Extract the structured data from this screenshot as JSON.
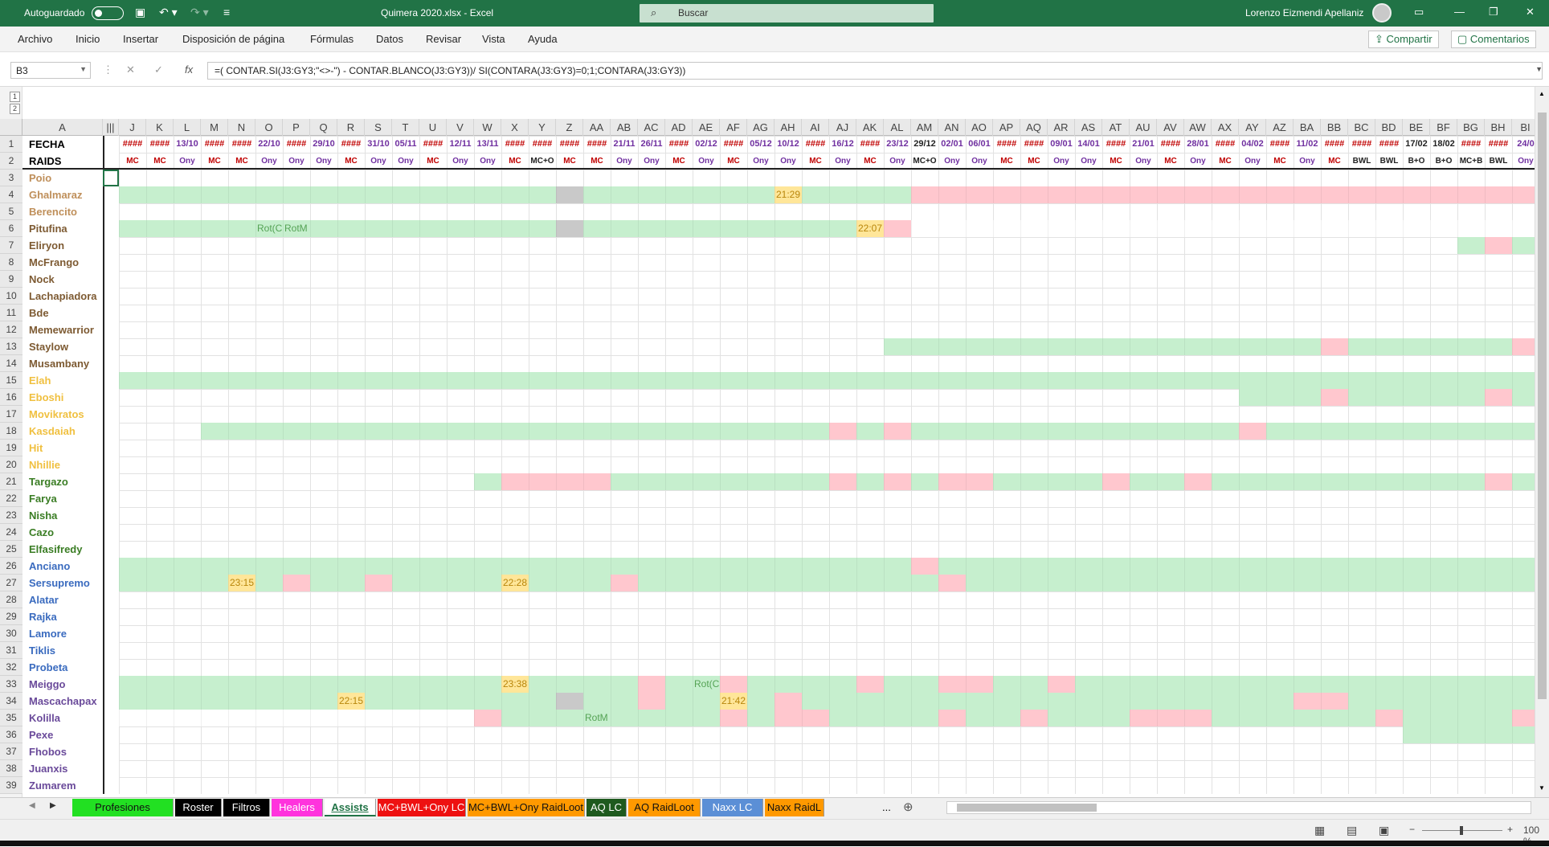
{
  "titlebar": {
    "autosave": "Autoguardado",
    "filename": "Quimera 2020.xlsx  -  Excel",
    "search": "Buscar",
    "user": "Lorenzo Eizmendi Apellaniz"
  },
  "menu": [
    "Archivo",
    "Inicio",
    "Insertar",
    "Disposición de página",
    "Fórmulas",
    "Datos",
    "Revisar",
    "Vista",
    "Ayuda"
  ],
  "ribbon_buttons": {
    "share": "Compartir",
    "comments": "Comentarios"
  },
  "formula_bar": {
    "name_box": "B3",
    "fx": "fx",
    "formula": "=( CONTAR.SI(J3:GY3;\"<>-\") - CONTAR.BLANCO(J3:GY3))/ SI(CONTARA(J3:GY3)=0;1;CONTARA(J3:GY3))"
  },
  "outline_levels": [
    "1",
    "2"
  ],
  "columns": [
    "J",
    "K",
    "L",
    "M",
    "N",
    "O",
    "P",
    "Q",
    "R",
    "S",
    "T",
    "U",
    "V",
    "W",
    "X",
    "Y",
    "Z",
    "AA",
    "AB",
    "AC",
    "AD",
    "AE",
    "AF",
    "AG",
    "AH",
    "AI",
    "AJ",
    "AK",
    "AL",
    "AM",
    "AN",
    "AO",
    "AP",
    "AQ",
    "AR",
    "AS",
    "AT",
    "AU",
    "AV",
    "AW",
    "AX",
    "AY",
    "AZ",
    "BA",
    "BB",
    "BC",
    "BD",
    "BE",
    "BF",
    "BG",
    "BH",
    "BI"
  ],
  "row1": {
    "label": "FECHA",
    "dates": [
      "####",
      "####",
      "13/10",
      "####",
      "####",
      "22/10",
      "####",
      "29/10",
      "####",
      "31/10",
      "05/11",
      "####",
      "12/11",
      "13/11",
      "####",
      "####",
      "####",
      "####",
      "21/11",
      "26/11",
      "####",
      "02/12",
      "####",
      "05/12",
      "10/12",
      "####",
      "16/12",
      "####",
      "23/12",
      "29/12",
      "02/01",
      "06/01",
      "####",
      "####",
      "09/01",
      "14/01",
      "####",
      "21/01",
      "####",
      "28/01",
      "####",
      "04/02",
      "####",
      "11/02",
      "####",
      "####",
      "####",
      "17/02",
      "18/02",
      "####",
      "####",
      "24/0"
    ]
  },
  "row2": {
    "label": "RAIDS",
    "raids": [
      "MC",
      "MC",
      "Ony",
      "MC",
      "MC",
      "Ony",
      "Ony",
      "Ony",
      "MC",
      "Ony",
      "Ony",
      "MC",
      "Ony",
      "Ony",
      "MC",
      "MC+O",
      "MC",
      "MC",
      "Ony",
      "Ony",
      "MC",
      "Ony",
      "MC",
      "Ony",
      "Ony",
      "MC",
      "Ony",
      "MC",
      "Ony",
      "MC+O",
      "Ony",
      "Ony",
      "MC",
      "MC",
      "Ony",
      "Ony",
      "MC",
      "Ony",
      "MC",
      "Ony",
      "MC",
      "Ony",
      "MC",
      "Ony",
      "MC",
      "BWL",
      "BWL",
      "B+O",
      "B+O",
      "MC+B",
      "BWL",
      "Ony"
    ]
  },
  "players": [
    {
      "row": "3",
      "name": "Poio",
      "color": "#bf8f5a"
    },
    {
      "row": "4",
      "name": "Ghalmaraz",
      "color": "#bf8f5a"
    },
    {
      "row": "5",
      "name": "Berencito",
      "color": "#bf8f5a"
    },
    {
      "row": "6",
      "name": "Pitufina",
      "color": "#7d5a32"
    },
    {
      "row": "7",
      "name": "Eliryon",
      "color": "#7d5a32"
    },
    {
      "row": "8",
      "name": "McFrango",
      "color": "#7d5a32"
    },
    {
      "row": "9",
      "name": "Nock",
      "color": "#7d5a32"
    },
    {
      "row": "10",
      "name": "Lachapiadora",
      "color": "#7d5a32"
    },
    {
      "row": "11",
      "name": "Bde",
      "color": "#7d5a32"
    },
    {
      "row": "12",
      "name": "Memewarrior",
      "color": "#7d5a32"
    },
    {
      "row": "13",
      "name": "Staylow",
      "color": "#7d5a32"
    },
    {
      "row": "14",
      "name": "Musambany",
      "color": "#7d5a32"
    },
    {
      "row": "15",
      "name": "Elah",
      "color": "#f0c040"
    },
    {
      "row": "16",
      "name": "Eboshi",
      "color": "#f0c040"
    },
    {
      "row": "17",
      "name": "Movikratos",
      "color": "#f0c040"
    },
    {
      "row": "18",
      "name": "Kasdaiah",
      "color": "#f0c040"
    },
    {
      "row": "19",
      "name": "Hit",
      "color": "#f0c040"
    },
    {
      "row": "20",
      "name": "Nhillie",
      "color": "#f0c040"
    },
    {
      "row": "21",
      "name": "Targazo",
      "color": "#3a7d24"
    },
    {
      "row": "22",
      "name": "Farya",
      "color": "#3a7d24"
    },
    {
      "row": "23",
      "name": "Nisha",
      "color": "#3a7d24"
    },
    {
      "row": "24",
      "name": "Cazo",
      "color": "#3a7d24"
    },
    {
      "row": "25",
      "name": "Elfasifredy",
      "color": "#3a7d24"
    },
    {
      "row": "26",
      "name": "Anciano",
      "color": "#3a6bbf"
    },
    {
      "row": "27",
      "name": "Sersupremo",
      "color": "#3a6bbf"
    },
    {
      "row": "28",
      "name": "Alatar",
      "color": "#3a6bbf"
    },
    {
      "row": "29",
      "name": "Rajka",
      "color": "#3a6bbf"
    },
    {
      "row": "30",
      "name": "Lamore",
      "color": "#3a6bbf"
    },
    {
      "row": "31",
      "name": "Tiklis",
      "color": "#3a6bbf"
    },
    {
      "row": "32",
      "name": "Probeta",
      "color": "#3a6bbf"
    },
    {
      "row": "33",
      "name": "Meiggo",
      "color": "#6a4a9a"
    },
    {
      "row": "34",
      "name": "Mascachapax",
      "color": "#6a4a9a"
    },
    {
      "row": "35",
      "name": "Kolilla",
      "color": "#6a4a9a"
    },
    {
      "row": "36",
      "name": "Pexe",
      "color": "#6a4a9a"
    },
    {
      "row": "37",
      "name": "Fhobos",
      "color": "#6a4a9a"
    },
    {
      "row": "38",
      "name": "Juanxis",
      "color": "#6a4a9a"
    },
    {
      "row": "39",
      "name": "Zumarem",
      "color": "#6a4a9a"
    }
  ],
  "cell_notes": [
    {
      "row": 4,
      "col": "AH",
      "text": "21:29"
    },
    {
      "row": 6,
      "col": "O",
      "text": "Rot(C"
    },
    {
      "row": 6,
      "col": "P",
      "text": "RotM"
    },
    {
      "row": 6,
      "col": "AK",
      "text": "22:07"
    },
    {
      "row": 27,
      "col": "N",
      "text": "23:15"
    },
    {
      "row": 27,
      "col": "X",
      "text": "22:28"
    },
    {
      "row": 33,
      "col": "X",
      "text": "23:38"
    },
    {
      "row": 33,
      "col": "AE",
      "text": "Rot(C"
    },
    {
      "row": 34,
      "col": "R",
      "text": "22:15"
    },
    {
      "row": 34,
      "col": "AF",
      "text": "21:42"
    },
    {
      "row": 35,
      "col": "AA",
      "text": "RotM"
    }
  ],
  "sheet_tabs": [
    {
      "label": "Profesiones",
      "bg": "#22e022",
      "fg": "#111"
    },
    {
      "label": "Roster",
      "bg": "#000000",
      "fg": "#fff"
    },
    {
      "label": "Filtros",
      "bg": "#000000",
      "fg": "#fff"
    },
    {
      "label": "Healers",
      "bg": "#ff33dd",
      "fg": "#fff"
    },
    {
      "label": "Assists",
      "bg": "#ffffff",
      "fg": "#217346"
    },
    {
      "label": "MC+BWL+Ony LC",
      "bg": "#ee1111",
      "fg": "#fff"
    },
    {
      "label": "MC+BWL+Ony RaidLoot",
      "bg": "#ff9900",
      "fg": "#111"
    },
    {
      "label": "AQ LC",
      "bg": "#1e5a1e",
      "fg": "#fff"
    },
    {
      "label": "AQ RaidLoot",
      "bg": "#ff9900",
      "fg": "#111"
    },
    {
      "label": "Naxx LC",
      "bg": "#5b8fd6",
      "fg": "#fff"
    },
    {
      "label": "Naxx RaidL",
      "bg": "#ff9900",
      "fg": "#111"
    }
  ],
  "tab_more": "...",
  "zoom": "100 %",
  "colors": {
    "green_fill": "#c6efce",
    "red_fill": "#ffc7ce",
    "yellow_fill": "#ffe699",
    "gray_fill": "#c9c9c9",
    "date_red": "#c00000",
    "date_purple": "#7030a0",
    "raid_red": "#c00000"
  }
}
